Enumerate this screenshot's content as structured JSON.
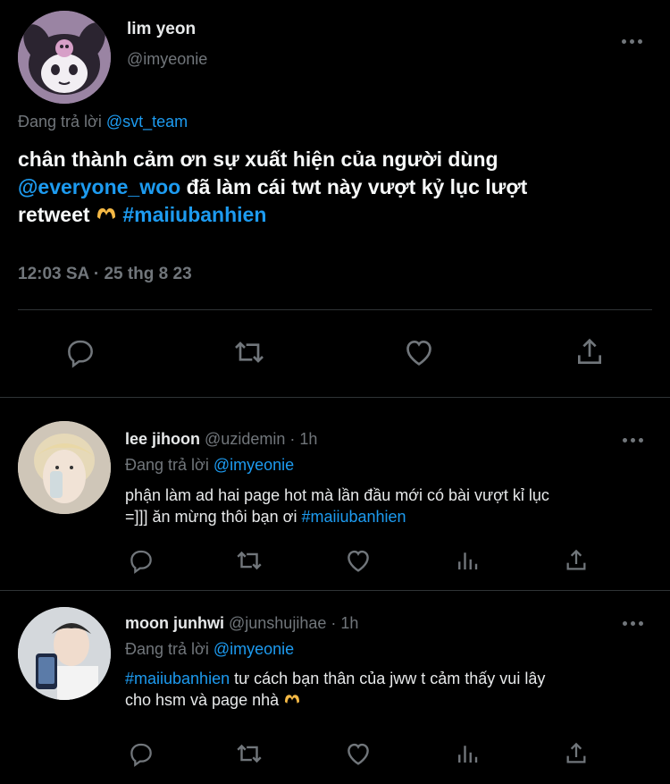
{
  "main_tweet": {
    "author_name": "lim yeon",
    "author_handle": "@imyeonie",
    "replying_prefix": "Đang trả lời",
    "replying_to": "@svt_team",
    "text_line1": "chân thành cảm ơn sự xuất hiện của người dùng",
    "mention": "@everyone_woo",
    "text_line2": "đã làm cái twt này vượt kỷ lục lượt",
    "text_line3": "retweet",
    "hashtag": "#maiiubanhien",
    "timestamp": "12:03 SA · 25 thg 8 23",
    "icons": [
      "reply-icon",
      "retweet-icon",
      "like-icon",
      "share-icon"
    ]
  },
  "replies": [
    {
      "author_name": "lee jihoon",
      "author_handle": "@uzidemin",
      "time_sep": "·",
      "time": "1h",
      "replying_prefix": "Đang trả lời",
      "replying_to": "@imyeonie",
      "text_line1": "phận làm ad hai page hot mà lần đầu mới có bài vượt kỉ lục",
      "text_line2": "=]]] ăn mừng thôi bạn ơi",
      "hashtag": "#maiiubanhien"
    },
    {
      "author_name": "moon junhwi",
      "author_handle": "@junshujihae",
      "time_sep": "·",
      "time": "1h",
      "replying_prefix": "Đang trả lời",
      "replying_to": "@imyeonie",
      "hashtag": "#maiiubanhien",
      "text_line1": "tư cách bạn thân của jww t cảm thấy vui lây",
      "text_line2": "cho hsm và page nhà"
    }
  ],
  "colors": {
    "background": "#000000",
    "link": "#1d9bf0",
    "muted": "#71767b",
    "text": "#e7e9ea",
    "divider": "#2f3336"
  }
}
